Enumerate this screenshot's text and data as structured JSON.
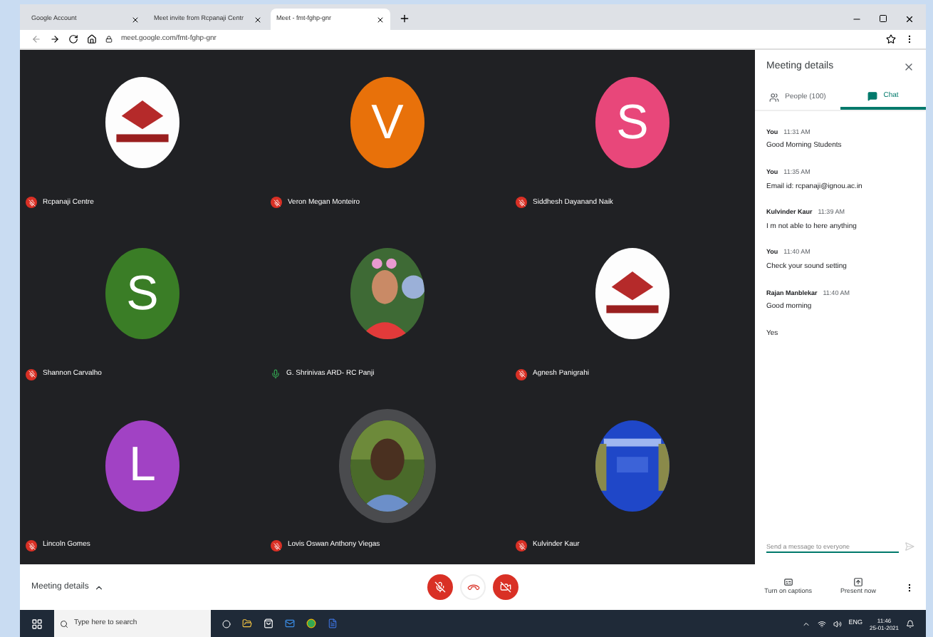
{
  "browser": {
    "tabs": [
      {
        "label": "Google Account",
        "selected": false
      },
      {
        "label": "Meet invite from Rcpanaji Centr",
        "selected": false
      },
      {
        "label": "Meet - fmt-fghp-gnr",
        "selected": true
      }
    ],
    "url": "meet.google.com/fmt-fghp-gnr"
  },
  "participants": [
    {
      "name": "Rcpanaji Centre",
      "muted": true
    },
    {
      "name": "Veron Megan Monteiro",
      "muted": true,
      "avatar": {
        "kind": "letter",
        "letter": "V",
        "color": "#e8710a"
      }
    },
    {
      "name": "Siddhesh Dayanand Naik",
      "muted": true,
      "avatar": {
        "kind": "letter",
        "letter": "S",
        "color": "#e8477a"
      }
    },
    {
      "name": "Shannon Carvalho",
      "muted": true,
      "avatar": {
        "kind": "letter",
        "letter": "S",
        "color": "#3a7d26"
      }
    },
    {
      "name": "G. Shrinivas ARD- RC Panji",
      "muted": false
    },
    {
      "name": "Agnesh Panigrahi",
      "muted": true
    },
    {
      "name": "Lincoln Gomes",
      "muted": true,
      "avatar": {
        "kind": "letter",
        "letter": "L",
        "color": "#a142c4"
      }
    },
    {
      "name": "Lovis Oswan Anthony Viegas",
      "muted": true
    },
    {
      "name": "Kulvinder Kaur",
      "muted": true
    }
  ],
  "sidebar": {
    "title": "Meeting details",
    "tabs": [
      {
        "label": "People (100)",
        "selected": false
      },
      {
        "label": "Chat",
        "selected": true
      }
    ],
    "messages": [
      {
        "sender": "You",
        "time": "11:31 AM",
        "text": "Good Morning Students"
      },
      {
        "sender": "You",
        "time": "11:35 AM",
        "text": "Email id: rcpanaji@ignou.ac.in"
      },
      {
        "sender": "Kulvinder Kaur",
        "time": "11:39 AM",
        "text": "I m not able to here anything"
      },
      {
        "sender": "You",
        "time": "11:40 AM",
        "text": "Check your sound setting"
      },
      {
        "sender": "Rajan Manblekar",
        "time": "11:40 AM",
        "text": "Good morning"
      },
      {
        "text": "Yes"
      }
    ],
    "input": {
      "placeholder": "Send a message to everyone"
    }
  },
  "bottom_bar": {
    "details": "Meeting details",
    "mic_on": false,
    "camera_on": false,
    "captions": "Turn on captions",
    "present": "Present now"
  },
  "taskbar": {
    "search": {
      "placeholder": "Type here to search"
    },
    "language": "ENG",
    "time": "11:46",
    "date": "25-01-2021"
  }
}
